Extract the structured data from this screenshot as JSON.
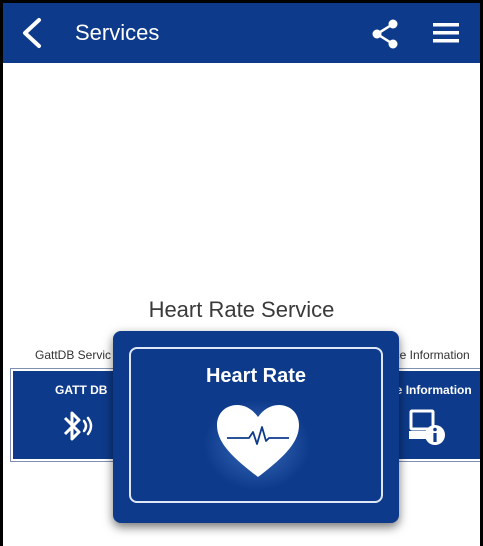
{
  "header": {
    "title": "Services",
    "back_icon": "chevron-left-icon",
    "share_icon": "share-icon",
    "menu_icon": "hamburger-menu-icon",
    "bg_color": "#0d3a8a"
  },
  "service_title": "Heart Rate Service",
  "carousel": {
    "left": {
      "caption": "GattDB Servic",
      "card_label": "GATT DB",
      "icon": "bluetooth-icon"
    },
    "center": {
      "card_label": "Heart Rate",
      "icon": "heart-pulse-icon"
    },
    "right": {
      "caption": "vice Information",
      "card_label": "vice Information",
      "icon": "device-info-icon"
    }
  },
  "colors": {
    "brand": "#0d3a8a",
    "text": "#3a3a3a",
    "white": "#ffffff"
  }
}
